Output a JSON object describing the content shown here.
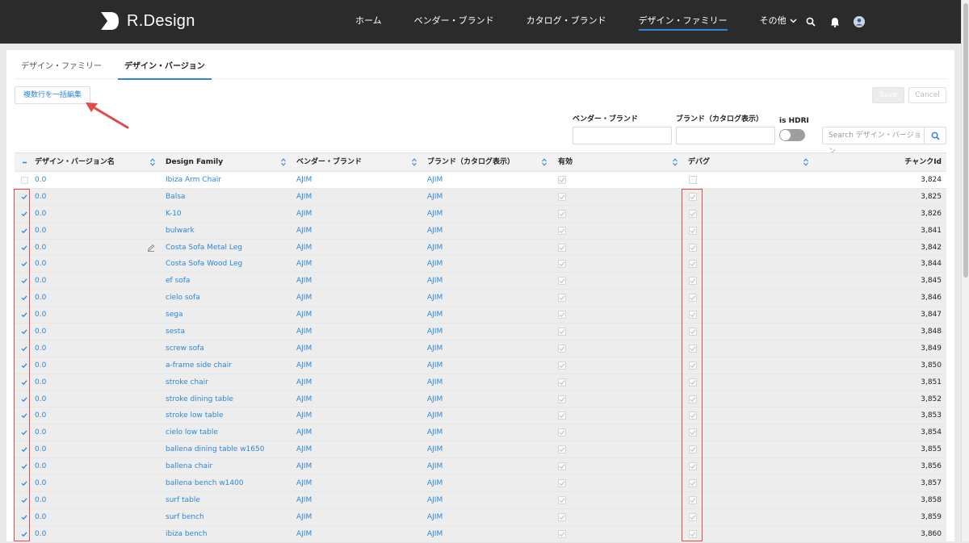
{
  "header": {
    "logo_text": "R.Design",
    "nav": [
      "ホーム",
      "ベンダー・ブランド",
      "カタログ・ブランド",
      "デザイン・ファミリー",
      "その他"
    ],
    "active_nav": 3
  },
  "tabs": [
    "デザイン・ファミリー",
    "デザイン・バージョン"
  ],
  "active_tab": 1,
  "toolbar": {
    "bulk_edit_label": "複数行を一括編集",
    "save_label": "Save",
    "cancel_label": "Cancel"
  },
  "filters": {
    "vendor_label": "ベンダー・ブランド",
    "brand_label": "ブランド（カタログ表示）",
    "hdri_label": "is HDRI",
    "search_placeholder": "Search デザイン・バージョン"
  },
  "table": {
    "columns": [
      "デザイン・バージョン名",
      "Design Family",
      "ベンダー・ブランド",
      "ブランド（カタログ表示）",
      "有効",
      "デバグ",
      "チャンクId"
    ],
    "rows": [
      {
        "version": "0.0",
        "family": "Ibiza Arm Chair",
        "vendor": "AJIM",
        "brand": "AJIM",
        "chunk": "3,824",
        "selected": false
      },
      {
        "version": "0.0",
        "family": "Balsa",
        "vendor": "AJIM",
        "brand": "AJIM",
        "chunk": "3,825",
        "selected": true
      },
      {
        "version": "0.0",
        "family": "K-10",
        "vendor": "AJIM",
        "brand": "AJIM",
        "chunk": "3,826",
        "selected": true
      },
      {
        "version": "0.0",
        "family": "bulwark",
        "vendor": "AJIM",
        "brand": "AJIM",
        "chunk": "3,841",
        "selected": true
      },
      {
        "version": "0.0",
        "family": "Costa Sofa Metal Leg",
        "vendor": "AJIM",
        "brand": "AJIM",
        "chunk": "3,842",
        "selected": true
      },
      {
        "version": "0.0",
        "family": "Costa Sofa Wood Leg",
        "vendor": "AJIM",
        "brand": "AJIM",
        "chunk": "3,844",
        "selected": true
      },
      {
        "version": "0.0",
        "family": "ef sofa",
        "vendor": "AJIM",
        "brand": "AJIM",
        "chunk": "3,845",
        "selected": true
      },
      {
        "version": "0.0",
        "family": "cielo sofa",
        "vendor": "AJIM",
        "brand": "AJIM",
        "chunk": "3,846",
        "selected": true
      },
      {
        "version": "0.0",
        "family": "sega",
        "vendor": "AJIM",
        "brand": "AJIM",
        "chunk": "3,847",
        "selected": true
      },
      {
        "version": "0.0",
        "family": "sesta",
        "vendor": "AJIM",
        "brand": "AJIM",
        "chunk": "3,848",
        "selected": true
      },
      {
        "version": "0.0",
        "family": "screw sofa",
        "vendor": "AJIM",
        "brand": "AJIM",
        "chunk": "3,849",
        "selected": true
      },
      {
        "version": "0.0",
        "family": "a-frame side chair",
        "vendor": "AJIM",
        "brand": "AJIM",
        "chunk": "3,850",
        "selected": true
      },
      {
        "version": "0.0",
        "family": "stroke chair",
        "vendor": "AJIM",
        "brand": "AJIM",
        "chunk": "3,851",
        "selected": true
      },
      {
        "version": "0.0",
        "family": "stroke dining table",
        "vendor": "AJIM",
        "brand": "AJIM",
        "chunk": "3,852",
        "selected": true
      },
      {
        "version": "0.0",
        "family": "stroke low table",
        "vendor": "AJIM",
        "brand": "AJIM",
        "chunk": "3,853",
        "selected": true
      },
      {
        "version": "0.0",
        "family": "cielo low table",
        "vendor": "AJIM",
        "brand": "AJIM",
        "chunk": "3,854",
        "selected": true
      },
      {
        "version": "0.0",
        "family": "ballena dining table w1650",
        "vendor": "AJIM",
        "brand": "AJIM",
        "chunk": "3,855",
        "selected": true
      },
      {
        "version": "0.0",
        "family": "ballena chair",
        "vendor": "AJIM",
        "brand": "AJIM",
        "chunk": "3,856",
        "selected": true
      },
      {
        "version": "0.0",
        "family": "ballena bench w1400",
        "vendor": "AJIM",
        "brand": "AJIM",
        "chunk": "3,857",
        "selected": true
      },
      {
        "version": "0.0",
        "family": "surf table",
        "vendor": "AJIM",
        "brand": "AJIM",
        "chunk": "3,858",
        "selected": true
      },
      {
        "version": "0.0",
        "family": "surf bench",
        "vendor": "AJIM",
        "brand": "AJIM",
        "chunk": "3,859",
        "selected": true
      },
      {
        "version": "0.0",
        "family": "ibiza bench",
        "vendor": "AJIM",
        "brand": "AJIM",
        "chunk": "3,860",
        "selected": true
      }
    ]
  },
  "colors": {
    "accent": "#2f86d6",
    "header_bg": "#2b2b2b",
    "annotation_red": "#e04a4a"
  }
}
